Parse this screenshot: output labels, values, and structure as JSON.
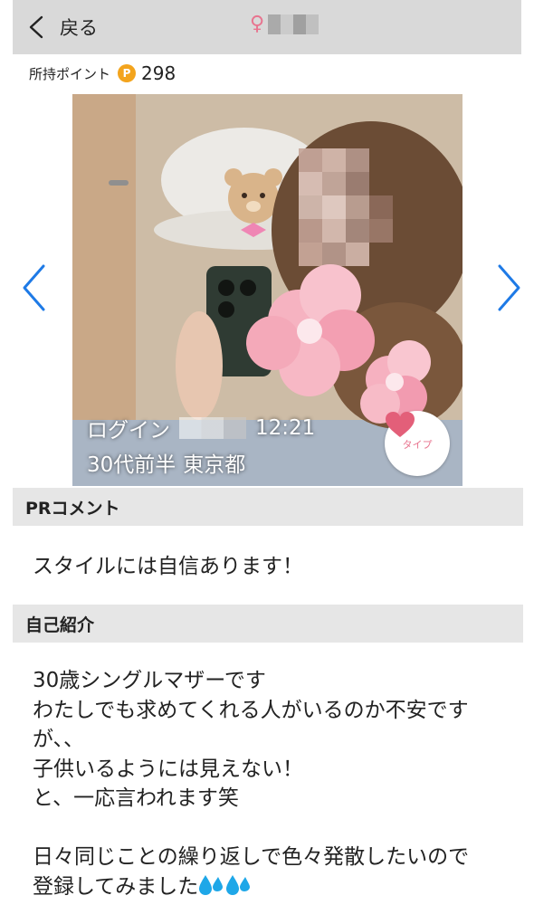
{
  "header": {
    "back_label": "戻る",
    "gender_symbol": "♀"
  },
  "points": {
    "label": "所持ポイント",
    "coin_letter": "P",
    "value": "298"
  },
  "photo": {
    "login_prefix": "ログイン",
    "login_time": "12:21",
    "age": "30代前半",
    "area": "東京都",
    "type_label": "タイプ"
  },
  "pr": {
    "heading": "PRコメント",
    "text": "スタイルには自信あります！"
  },
  "intro": {
    "heading": "自己紹介",
    "text": "30歳シングルマザーです\nわたしでも求めてくれる人がいるのか不安です\nが、、\n子供いるようには見えない！\nと、一応言われます笑\n\n日々同じことの繰り返しで色々発散したいので\n登録してみました",
    "trailing_icons": [
      "sweat-drops-icon",
      "sweat-drops-icon"
    ]
  },
  "colors": {
    "accent_blue": "#1e7ae6",
    "pink": "#e8748f",
    "coin": "#f3a41d",
    "header_bg": "#d9d9d9",
    "section_bg": "#e6e6e6"
  }
}
